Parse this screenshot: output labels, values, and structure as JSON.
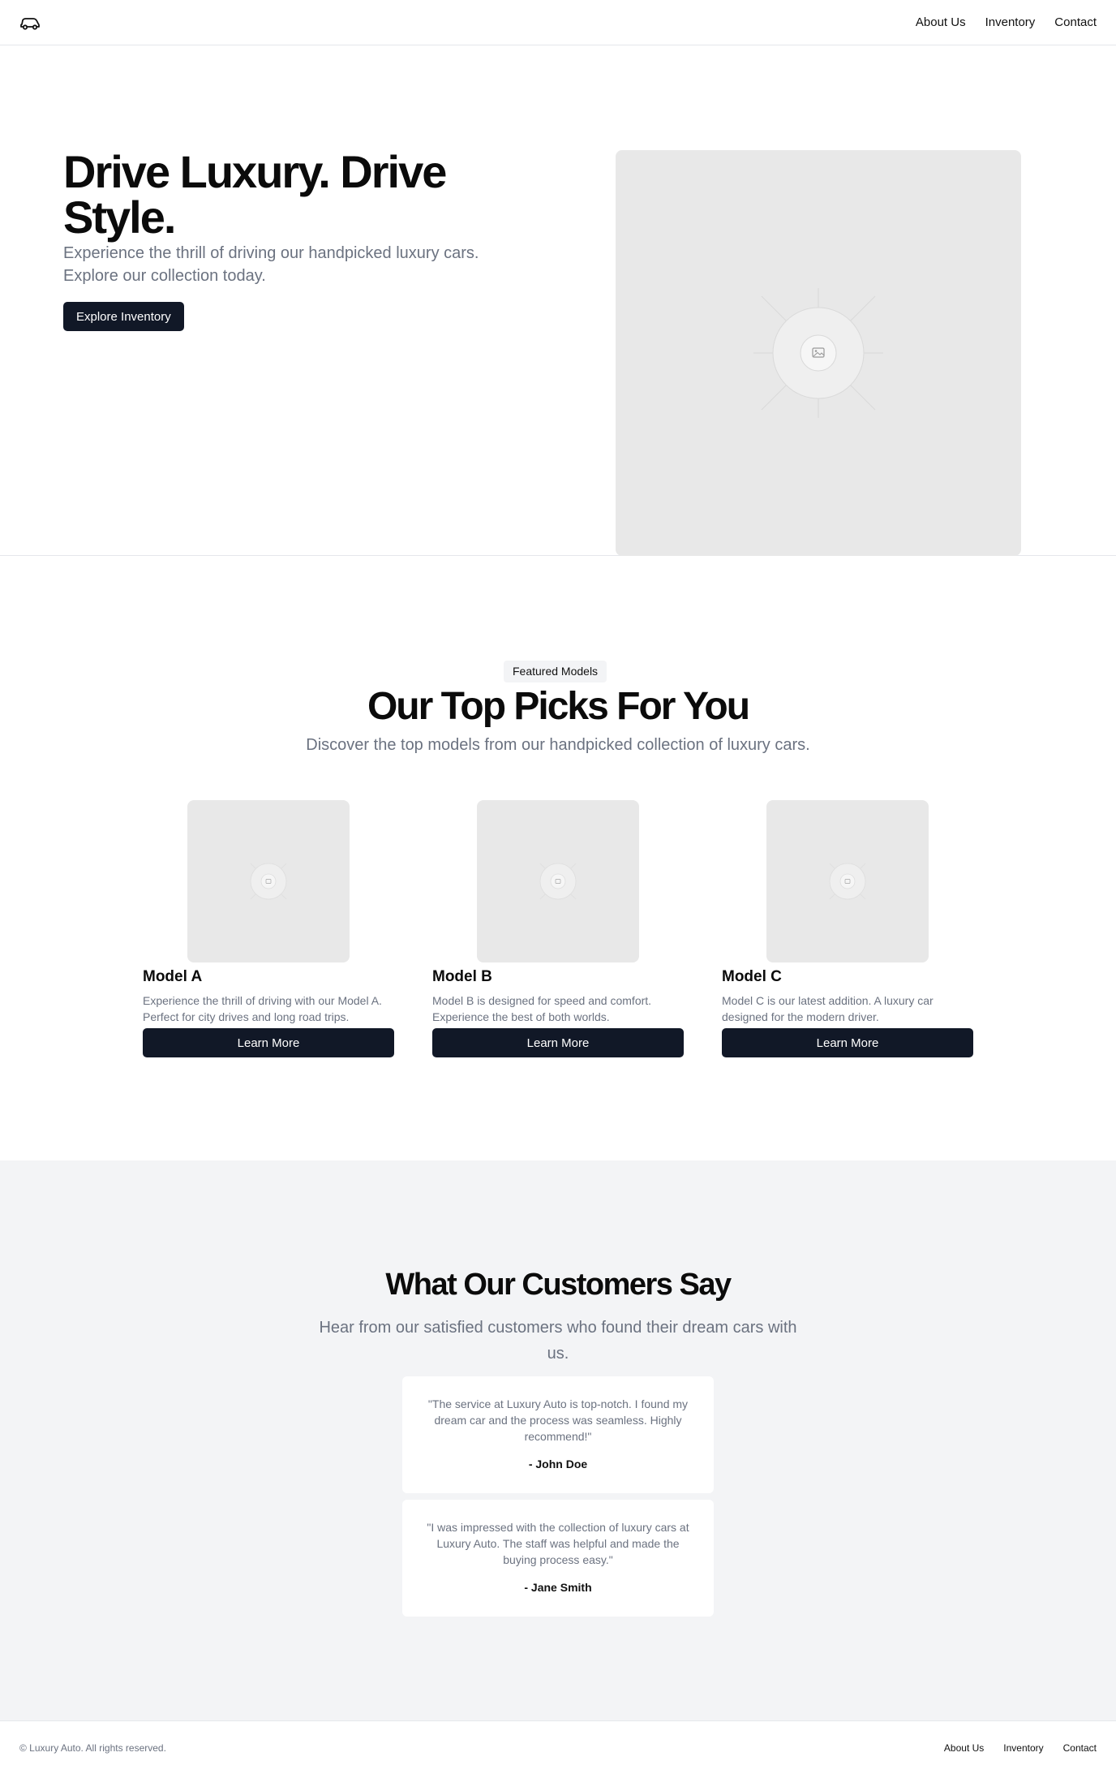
{
  "header": {
    "logo_icon": "car-icon",
    "nav": [
      "About Us",
      "Inventory",
      "Contact"
    ]
  },
  "hero": {
    "title": "Drive Luxury. Drive Style.",
    "subtitle": "Experience the thrill of driving our handpicked luxury cars. Explore our collection today.",
    "cta": "Explore Inventory",
    "image_icon": "image-placeholder-icon"
  },
  "featured": {
    "badge": "Featured Models",
    "title": "Our Top Picks For You",
    "subtitle": "Discover the top models from our handpicked collection of luxury cars.",
    "cards": [
      {
        "name": "Model A",
        "description": "Experience the thrill of driving with our Model A. Perfect for city drives and long road trips.",
        "button": "Learn More"
      },
      {
        "name": "Model B",
        "description": "Model B is designed for speed and comfort. Experience the best of both worlds.",
        "button": "Learn More"
      },
      {
        "name": "Model C",
        "description": "Model C is our latest addition. A luxury car designed for the modern driver.",
        "button": "Learn More"
      }
    ]
  },
  "testimonials": {
    "title": "What Our Customers Say",
    "subtitle": "Hear from our satisfied customers who found their dream cars with us.",
    "items": [
      {
        "quote": "\"The service at Luxury Auto is top-notch. I found my dream car and the process was seamless. Highly recommend!\"",
        "author": "- John Doe"
      },
      {
        "quote": "\"I was impressed with the collection of luxury cars at Luxury Auto. The staff was helpful and made the buying process easy.\"",
        "author": "- Jane Smith"
      }
    ]
  },
  "footer": {
    "copyright": "© Luxury Auto. All rights reserved.",
    "nav": [
      "About Us",
      "Inventory",
      "Contact"
    ]
  },
  "colors": {
    "primary_button": "#111827",
    "muted_text": "#6b7280",
    "section_bg": "#f3f4f6",
    "placeholder_bg": "#e8e8e8"
  }
}
